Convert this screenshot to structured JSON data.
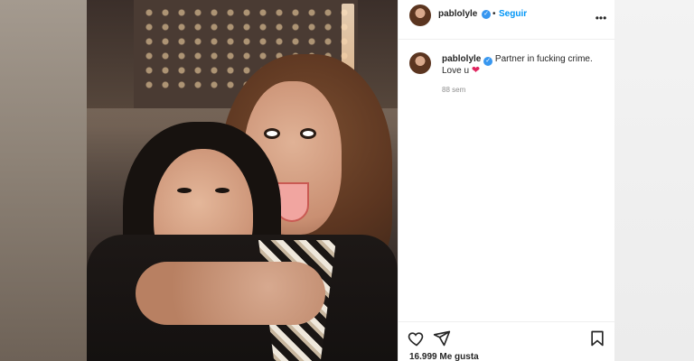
{
  "post": {
    "username": "pablolyle",
    "follow_label": "Seguir",
    "separator": "•",
    "more_icon": "more-icon",
    "caption_text": "Partner in fucking crime. Love u",
    "caption_emoji": "heart-emoji",
    "time_ago": "88 sem",
    "likes_count": "16.999",
    "likes_label": "Me gusta",
    "verified_icon": "verified-badge-icon"
  },
  "colors": {
    "link_blue": "#0095f6",
    "verified_blue": "#3897f0",
    "heart_red": "#e0245e",
    "text_primary": "#262626",
    "text_secondary": "#8e8e8e"
  },
  "footer_icons": [
    "heart-icon",
    "share-icon",
    "bookmark-icon"
  ]
}
